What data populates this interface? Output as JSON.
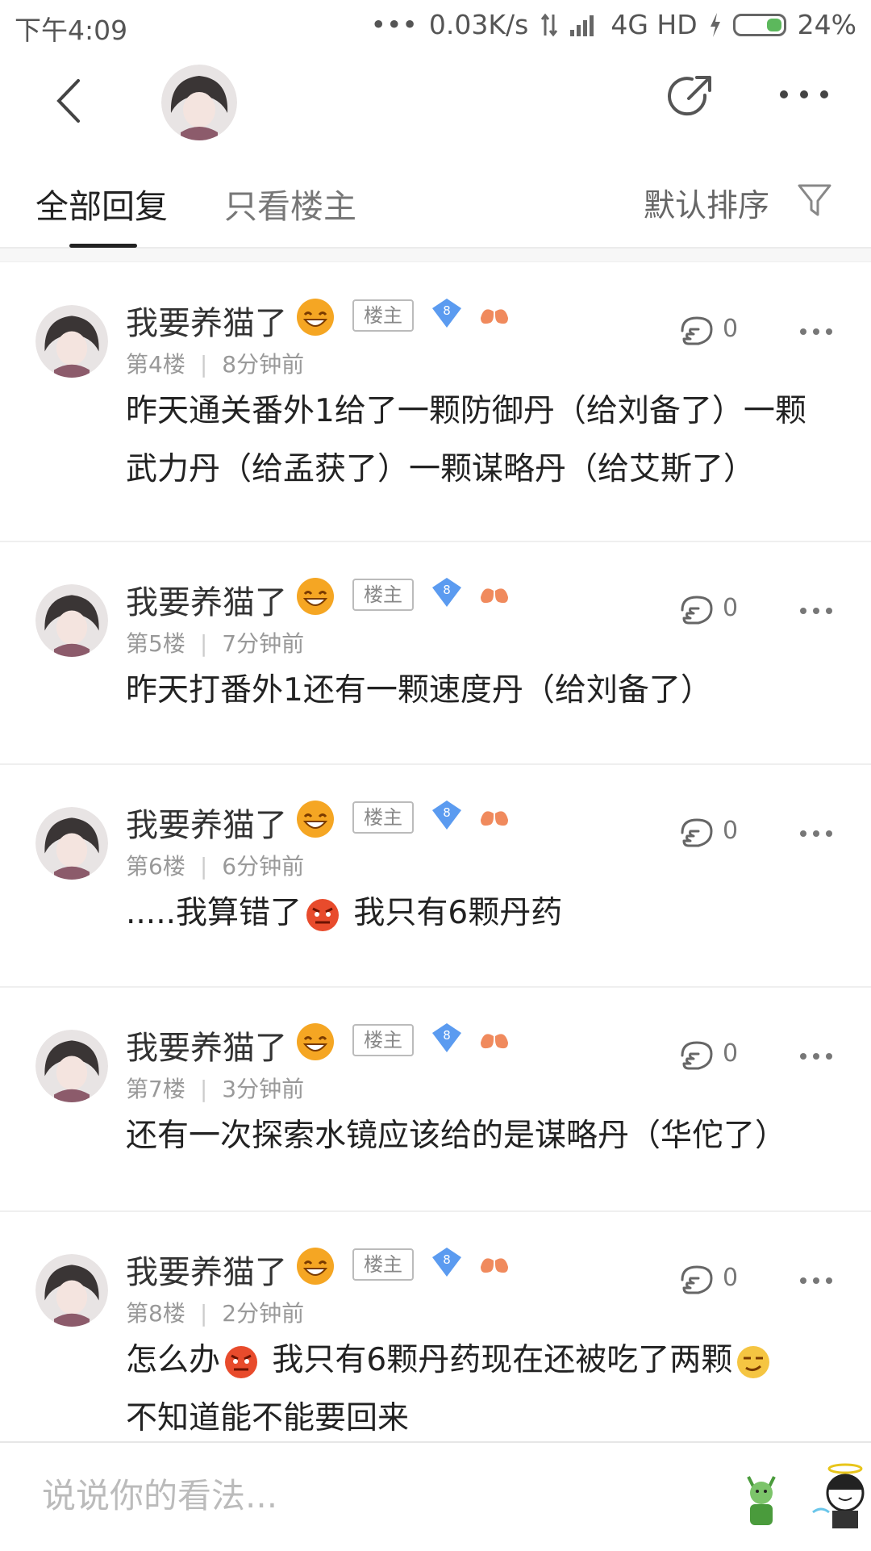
{
  "status_bar": {
    "time": "下午4:09",
    "dots": "•••",
    "speed": "0.03K/s",
    "network": "4G HD",
    "battery": "24%"
  },
  "nav": {
    "icons": [
      "back-icon",
      "avatar",
      "share-icon",
      "more-icon"
    ]
  },
  "tabs": {
    "all_replies": "全部回复",
    "owner_only": "只看楼主",
    "sort": "默认排序"
  },
  "colors": {
    "level_badge": "#5b9bf0",
    "battery_fill": "#5cb85c",
    "emoji": "#f5a623",
    "angry_emoji": "#e84b2c"
  },
  "posts": [
    {
      "username": "我要养猫了",
      "owner_badge": "楼主",
      "level": "8",
      "floor": "第4楼",
      "time": "8分钟前",
      "likes": "0",
      "lines": [
        "昨天通关番外1给了一颗防御丹（给刘备了）一颗",
        "武力丹（给孟获了）一颗谋略丹（给艾斯了）"
      ]
    },
    {
      "username": "我要养猫了",
      "owner_badge": "楼主",
      "level": "8",
      "floor": "第5楼",
      "time": "7分钟前",
      "likes": "0",
      "lines": [
        "昨天打番外1还有一颗速度丹（给刘备了）"
      ]
    },
    {
      "username": "我要养猫了",
      "owner_badge": "楼主",
      "level": "8",
      "floor": "第6楼",
      "time": "6分钟前",
      "likes": "0",
      "text_a": ".....我算错了",
      "text_b": " 我只有6颗丹药"
    },
    {
      "username": "我要养猫了",
      "owner_badge": "楼主",
      "level": "8",
      "floor": "第7楼",
      "time": "3分钟前",
      "likes": "0",
      "lines": [
        "还有一次探索水镜应该给的是谋略丹（华佗了）"
      ]
    },
    {
      "username": "我要养猫了",
      "owner_badge": "楼主",
      "level": "8",
      "floor": "第8楼",
      "time": "2分钟前",
      "likes": "0",
      "text_a": "怎么办",
      "text_b": " 我只有6颗丹药现在还被吃了两颗",
      "line2": "不知道能不能要回来"
    }
  ],
  "bottom": {
    "placeholder": "说说你的看法..."
  }
}
